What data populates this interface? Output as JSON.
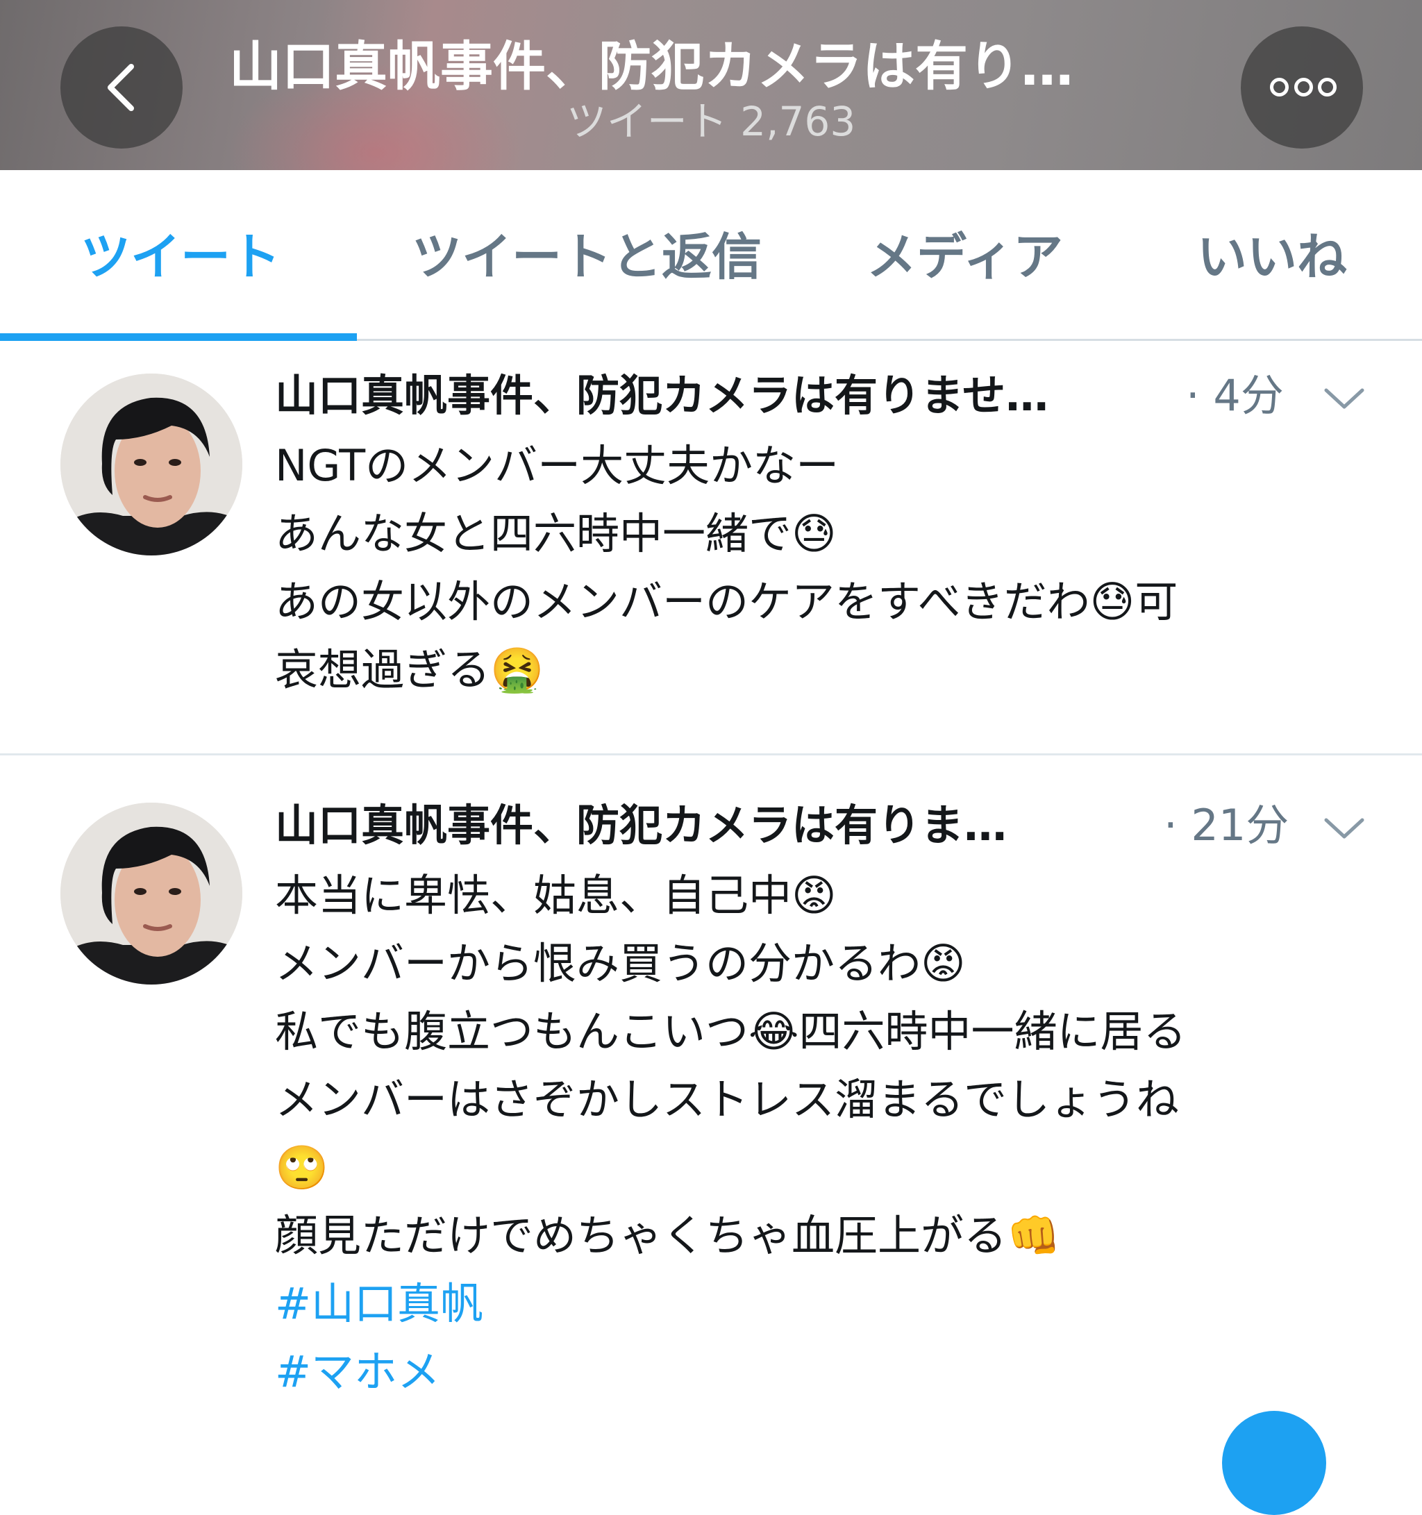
{
  "header": {
    "title": "山口真帆事件、防犯カメラは有り…",
    "subtitle": "ツイート 2,763"
  },
  "tabs": [
    {
      "label": "ツイート",
      "active": true
    },
    {
      "label": "ツイートと返信",
      "active": false
    },
    {
      "label": "メディア",
      "active": false
    },
    {
      "label": "いいね",
      "active": false
    }
  ],
  "tweets": [
    {
      "name": "山口真帆事件、防犯カメラは有りませ…",
      "time": "· 4分",
      "lines": [
        "NGTのメンバー大丈夫かなー",
        "あんな女と四六時中一緒で😓",
        "あの女以外のメンバーのケアをすべきだわ😓可",
        "哀想過ぎる🤮"
      ]
    },
    {
      "name": "山口真帆事件、防犯カメラは有りま…",
      "time": "· 21分",
      "lines": [
        "本当に卑怯、姑息、自己中😡",
        "メンバーから恨み買うの分かるわ😡",
        "私でも腹立つもんこいつ😂四六時中一緒に居る",
        "メンバーはさぞかしストレス溜まるでしょうね",
        "🙄",
        "顔見ただけでめちゃくちゃ血圧上がる👊"
      ],
      "hashtags": [
        "#山口真帆",
        "#マホメ"
      ]
    }
  ],
  "colors": {
    "accent": "#1da1f2",
    "secondary_text": "#657786",
    "primary_text": "#14171a"
  },
  "icons": {
    "back": "chevron-left-icon",
    "more": "more-icon",
    "caret": "chevron-down-icon"
  }
}
